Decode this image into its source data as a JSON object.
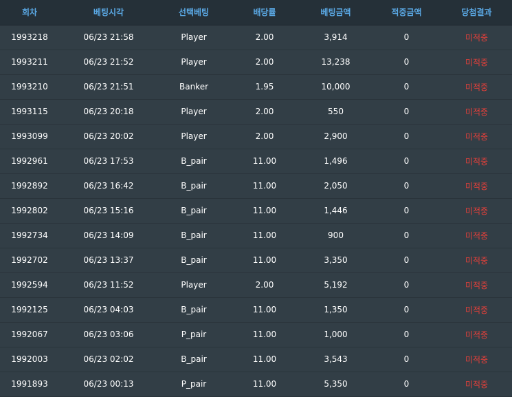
{
  "colors": {
    "header_text": "#5aa8e4",
    "header_bg": "#253038",
    "row_bg": "#323e46",
    "cell_text": "#ffffff",
    "result_text": "#e8403a"
  },
  "table": {
    "headers": [
      "회차",
      "베팅시각",
      "선택베팅",
      "배당률",
      "베팅금액",
      "적중금액",
      "당첨결과"
    ],
    "rows": [
      [
        "1993218",
        "06/23 21:58",
        "Player",
        "2.00",
        "3,914",
        "0",
        "미적중"
      ],
      [
        "1993211",
        "06/23 21:52",
        "Player",
        "2.00",
        "13,238",
        "0",
        "미적중"
      ],
      [
        "1993210",
        "06/23 21:51",
        "Banker",
        "1.95",
        "10,000",
        "0",
        "미적중"
      ],
      [
        "1993115",
        "06/23 20:18",
        "Player",
        "2.00",
        "550",
        "0",
        "미적중"
      ],
      [
        "1993099",
        "06/23 20:02",
        "Player",
        "2.00",
        "2,900",
        "0",
        "미적중"
      ],
      [
        "1992961",
        "06/23 17:53",
        "B_pair",
        "11.00",
        "1,496",
        "0",
        "미적중"
      ],
      [
        "1992892",
        "06/23 16:42",
        "B_pair",
        "11.00",
        "2,050",
        "0",
        "미적중"
      ],
      [
        "1992802",
        "06/23 15:16",
        "B_pair",
        "11.00",
        "1,446",
        "0",
        "미적중"
      ],
      [
        "1992734",
        "06/23 14:09",
        "B_pair",
        "11.00",
        "900",
        "0",
        "미적중"
      ],
      [
        "1992702",
        "06/23 13:37",
        "B_pair",
        "11.00",
        "3,350",
        "0",
        "미적중"
      ],
      [
        "1992594",
        "06/23 11:52",
        "Player",
        "2.00",
        "5,192",
        "0",
        "미적중"
      ],
      [
        "1992125",
        "06/23 04:03",
        "B_pair",
        "11.00",
        "1,350",
        "0",
        "미적중"
      ],
      [
        "1992067",
        "06/23 03:06",
        "P_pair",
        "11.00",
        "1,000",
        "0",
        "미적중"
      ],
      [
        "1992003",
        "06/23 02:02",
        "B_pair",
        "11.00",
        "3,543",
        "0",
        "미적중"
      ],
      [
        "1991893",
        "06/23 00:13",
        "P_pair",
        "11.00",
        "5,350",
        "0",
        "미적중"
      ]
    ]
  }
}
